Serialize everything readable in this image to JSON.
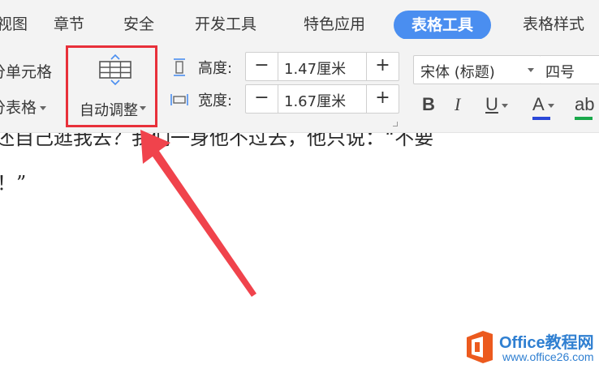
{
  "tabs": [
    {
      "label": "视图"
    },
    {
      "label": "章节"
    },
    {
      "label": "安全"
    },
    {
      "label": "开发工具"
    },
    {
      "label": "特色应用"
    },
    {
      "label": "表格工具"
    },
    {
      "label": "表格样式"
    }
  ],
  "active_tab": "表格工具",
  "ribbon": {
    "split_cells": "分单元格",
    "split_table": "分表格",
    "autofit_label": "自动调整",
    "height_label": "高度:",
    "height_value": "1.47厘米",
    "width_label": "宽度:",
    "width_value": "1.67厘米",
    "minus": "−",
    "plus": "+",
    "font_name": "宋体 (标题)",
    "font_size": "四号",
    "bold": "B",
    "italic": "I",
    "underline": "U",
    "font_color": "A",
    "highlight": "ab"
  },
  "document": {
    "line1": "还自己逛我去？我们一身他不过去，他只说：“不要",
    "line2": "！”"
  },
  "watermark": {
    "title": "Office教程网",
    "url": "www.office26.com"
  },
  "colors": {
    "accent": "#4a8ef0",
    "highlight": "#e8303a",
    "font_color_bar": "#2a47d8",
    "watermark": "#2f7fd1",
    "logo": "#ec5a1e"
  }
}
